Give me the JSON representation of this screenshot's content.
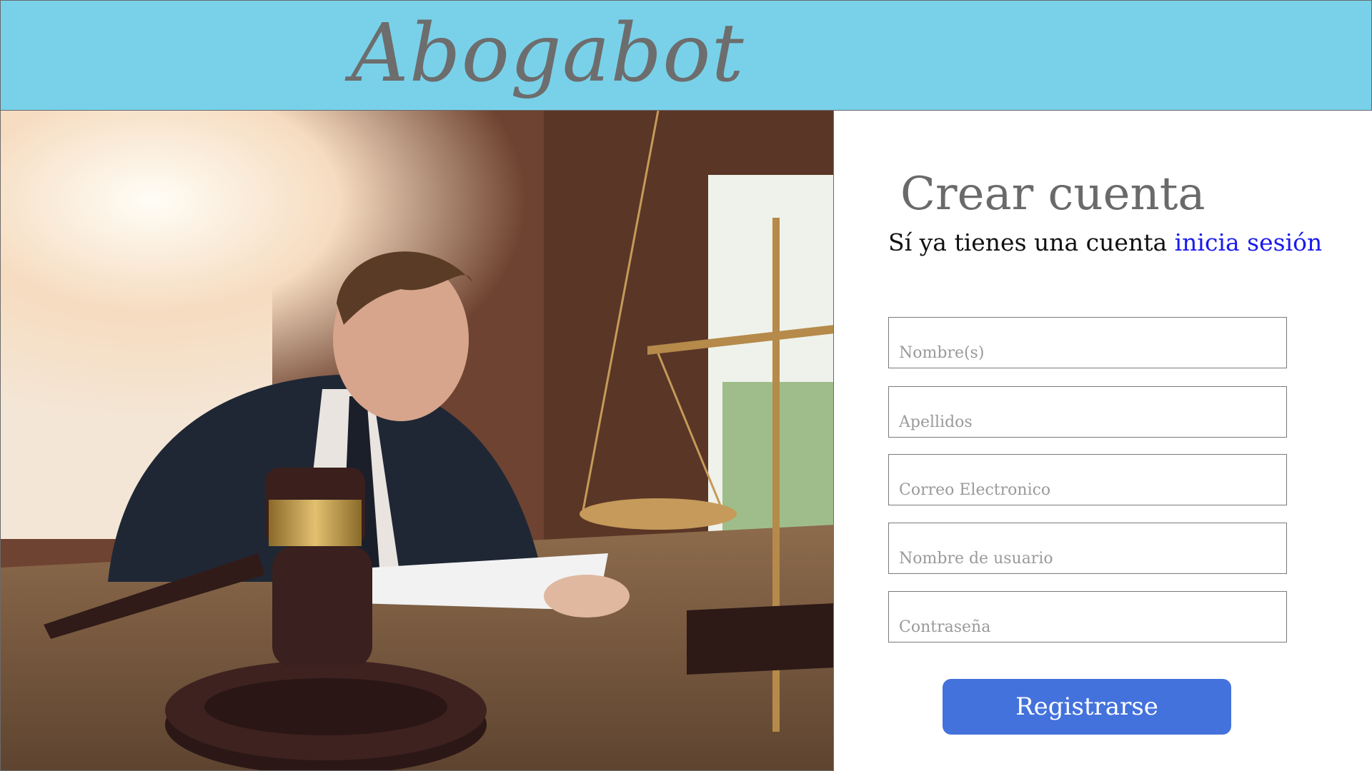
{
  "header": {
    "brand": "Abogabot"
  },
  "hero": {
    "image": "lawyer-writing-with-gavel-and-scales"
  },
  "form": {
    "title": "Crear cuenta",
    "subtitle_prefix": "Sí ya tienes una cuenta ",
    "login_link": "inicia sesión",
    "fields": [
      {
        "placeholder": "Nombre(s)",
        "value": ""
      },
      {
        "placeholder": "Apellidos",
        "value": ""
      },
      {
        "placeholder": "Correo Electronico",
        "value": ""
      },
      {
        "placeholder": "Nombre de usuario",
        "value": ""
      },
      {
        "placeholder": "Contraseña",
        "value": ""
      }
    ],
    "submit_label": "Registrarse"
  },
  "colors": {
    "header_bg": "#79d1e9",
    "brand_text": "#6d6d6d",
    "link": "#1a1aee",
    "button": "#4472dc"
  }
}
